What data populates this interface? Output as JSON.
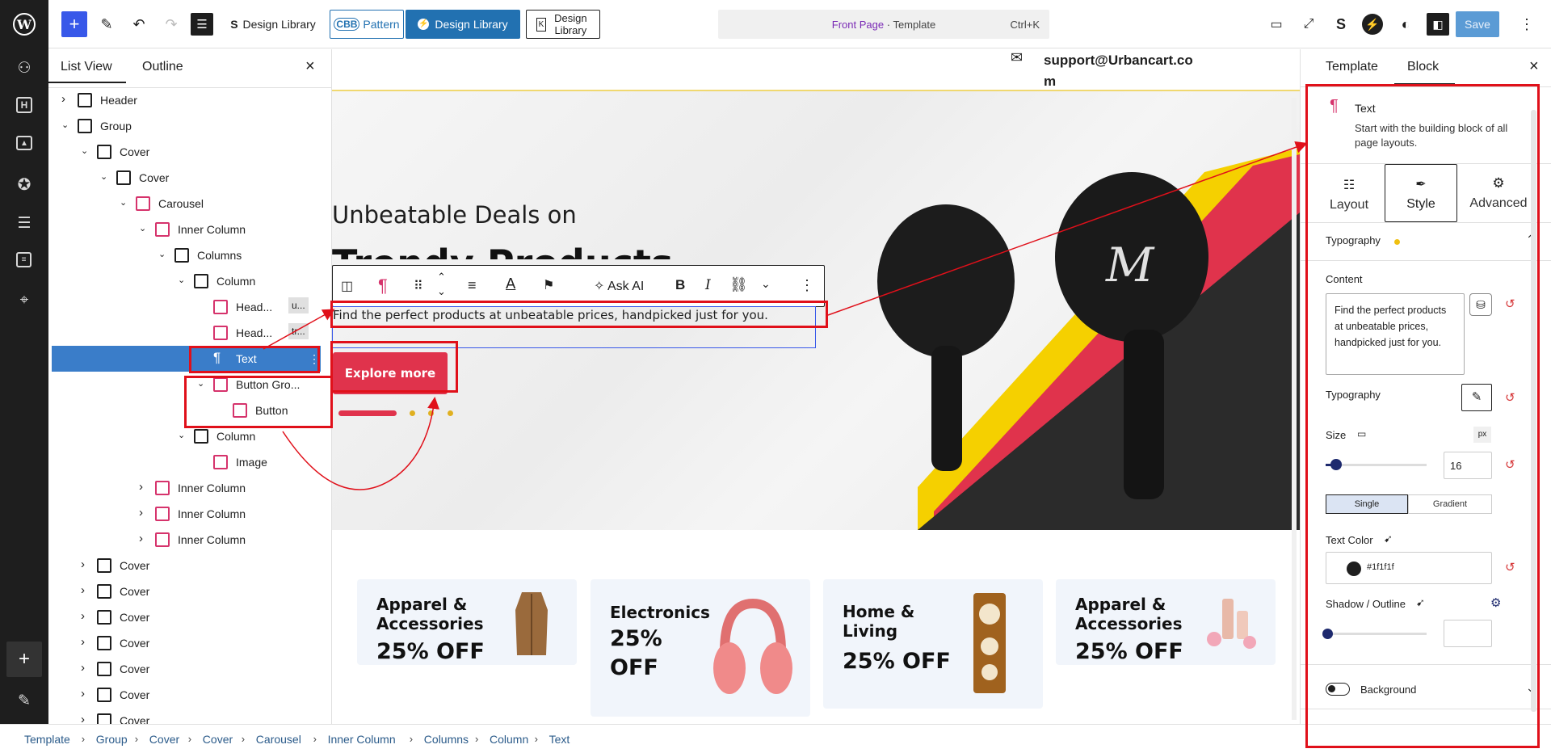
{
  "topbar": {
    "design_library_1": "Design Library",
    "pattern_prefix": "CBB",
    "pattern": "Pattern",
    "design_library_2": "Design Library",
    "design_library_3": "Design Library",
    "doc_title": "Front Page",
    "doc_type": "· Template",
    "shortcut": "Ctrl+K",
    "save": "Save"
  },
  "listview": {
    "tab_list": "List View",
    "tab_outline": "Outline",
    "close": "×",
    "items": [
      {
        "label": "Header",
        "depth": 0,
        "open": false
      },
      {
        "label": "Group",
        "depth": 0,
        "open": true
      },
      {
        "label": "Cover",
        "depth": 1,
        "open": true
      },
      {
        "label": "Cover",
        "depth": 2,
        "open": true
      },
      {
        "label": "Carousel",
        "depth": 3,
        "open": true
      },
      {
        "label": "Inner Column",
        "depth": 4,
        "open": true
      },
      {
        "label": "Columns",
        "depth": 5,
        "open": true
      },
      {
        "label": "Column",
        "depth": 6,
        "open": true
      },
      {
        "label": "Head...",
        "depth": 7,
        "badge": "u..."
      },
      {
        "label": "Head...",
        "depth": 7,
        "badge": "tr..."
      },
      {
        "label": "Text",
        "depth": 7,
        "selected": true
      },
      {
        "label": "Button Gro...",
        "depth": 7,
        "open": true
      },
      {
        "label": "Button",
        "depth": 8
      },
      {
        "label": "Column",
        "depth": 6,
        "open": true
      },
      {
        "label": "Image",
        "depth": 7
      },
      {
        "label": "Inner Column",
        "depth": 4,
        "open": false
      },
      {
        "label": "Inner Column",
        "depth": 4,
        "open": false
      },
      {
        "label": "Inner Column",
        "depth": 4,
        "open": false
      },
      {
        "label": "Cover",
        "depth": 1,
        "open": false
      },
      {
        "label": "Cover",
        "depth": 1,
        "open": false
      },
      {
        "label": "Cover",
        "depth": 1,
        "open": false
      },
      {
        "label": "Cover",
        "depth": 1,
        "open": false
      },
      {
        "label": "Cover",
        "depth": 1,
        "open": false
      },
      {
        "label": "Cover",
        "depth": 1,
        "open": false
      },
      {
        "label": "Cover",
        "depth": 1,
        "open": false
      }
    ]
  },
  "canvas": {
    "email_line1": "support@Urbancart.co",
    "email_line2": "m",
    "hero_heading": "Unbeatable Deals on",
    "hero_sub": "Trendy Products",
    "hero_text": "Find the perfect products at unbeatable prices, handpicked just for you.",
    "cta": "Explore more",
    "ask_ai": "Ask AI",
    "cards": [
      {
        "title": "Apparel &\nAccessories",
        "off": "25% OFF"
      },
      {
        "title": "Electronics",
        "off": "25%\nOFF"
      },
      {
        "title": "Home &\nLiving",
        "off": "25% OFF"
      },
      {
        "title": "Apparel &\nAccessories",
        "off": "25% OFF"
      }
    ]
  },
  "settings": {
    "tab_template": "Template",
    "tab_block": "Block",
    "block_name": "Text",
    "block_desc": "Start with the building block of all page layouts.",
    "subtabs": [
      "Layout",
      "Style",
      "Advanced"
    ],
    "typography_header": "Typography",
    "content_label": "Content",
    "content_value": "Find the perfect products at unbeatable prices, handpicked just for you.",
    "typography_label": "Typography",
    "size_label": "Size",
    "size_unit": "px",
    "size_value": "16",
    "size_fraction": 0.08,
    "color_single": "Single",
    "color_gradient": "Gradient",
    "text_color_label": "Text Color",
    "text_color_value": "#1f1f1f",
    "shadow_label": "Shadow / Outline",
    "background_label": "Background"
  },
  "breadcrumbs": [
    "Template",
    "Group",
    "Cover",
    "Cover",
    "Carousel",
    "Inner Column",
    "Columns",
    "Column",
    "Text"
  ],
  "colors": {
    "accent": "#3858e9",
    "primary_blue": "#2271b1",
    "selected_row": "#3a7dc9",
    "brand_red": "#e0334c",
    "brand_yellow": "#f5d000",
    "annotation": "#e0101a"
  }
}
